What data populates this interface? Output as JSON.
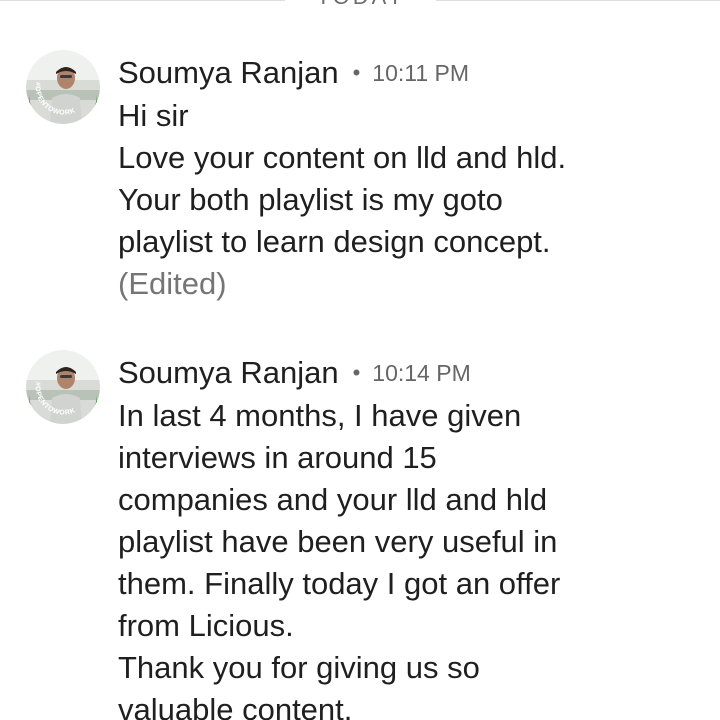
{
  "divider": {
    "label": "TODAY"
  },
  "messages": [
    {
      "sender": "Soumya Ranjan",
      "separator": "•",
      "time": "10:11 PM",
      "lines": [
        "Hi sir",
        "Love your content on lld and hld.",
        "Your both playlist is my goto",
        "playlist to learn design concept."
      ],
      "edited_label": "(Edited)",
      "avatar": {
        "ring_text": "#OPENTOWORK",
        "ring_color": "#2f7a2f"
      }
    },
    {
      "sender": "Soumya Ranjan",
      "separator": "•",
      "time": "10:14 PM",
      "lines": [
        "In last 4 months, I have given",
        "interviews in around 15",
        "companies and your lld and hld",
        "playlist have been very useful in",
        "them. Finally today I got an offer",
        "from Licious.",
        "Thank you for giving us so",
        "valuable content."
      ],
      "avatar": {
        "ring_text": "#OPENTOWORK",
        "ring_color": "#2f7a2f"
      }
    }
  ]
}
